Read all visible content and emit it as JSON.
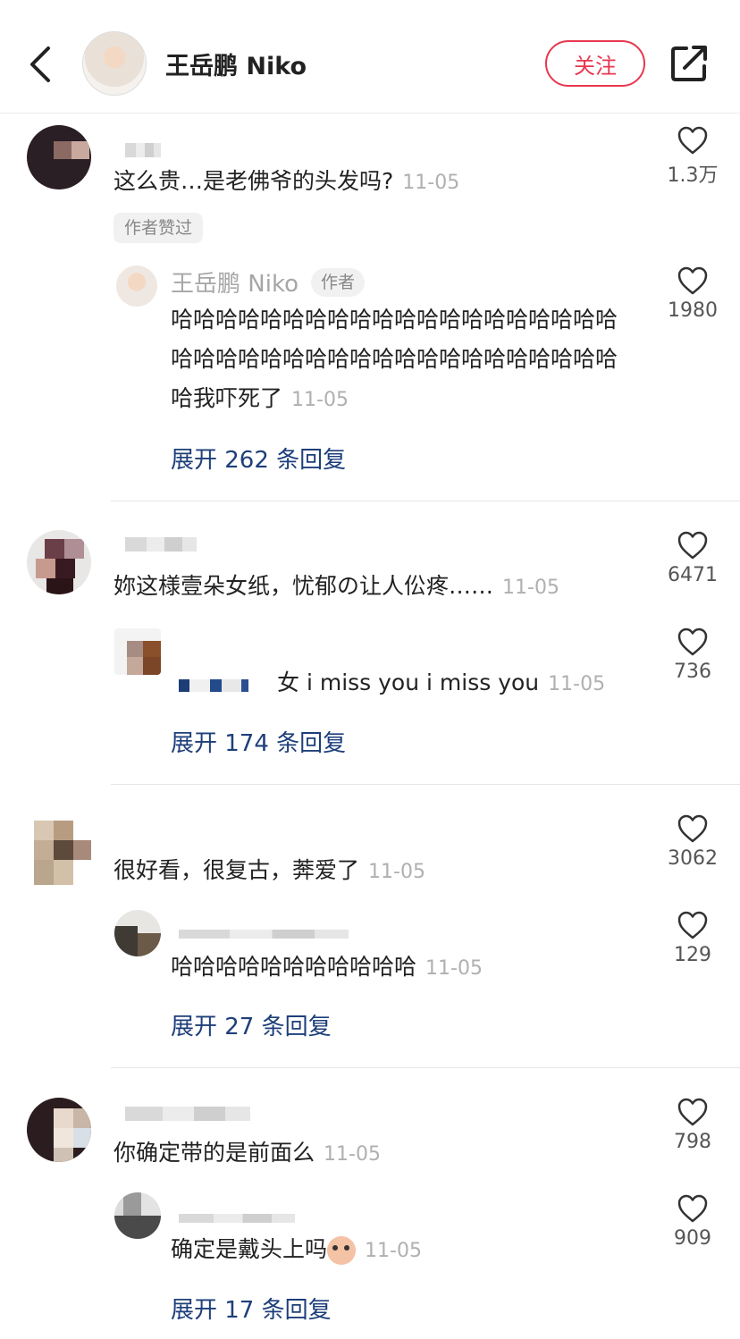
{
  "header": {
    "author_name": "王岳鹏 Niko",
    "follow_label": "关注"
  },
  "comments": [
    {
      "text": "这么贵…是老佛爷的头发吗?",
      "time": "11-05",
      "likes": "1.3万",
      "liked_tag": "作者赞过",
      "reply": {
        "author": "王岳鹏 Niko",
        "author_tag": "作者",
        "text": "哈哈哈哈哈哈哈哈哈哈哈哈哈哈哈哈哈哈哈哈哈哈哈哈哈哈哈哈哈哈哈哈哈哈哈哈哈哈哈哈哈我吓死了",
        "time": "11-05",
        "likes": "1980"
      },
      "expand": "展开 262 条回复"
    },
    {
      "text": "妳这様壹朵女纸，忧郁の让人伀疼……",
      "time": "11-05",
      "likes": "6471",
      "reply": {
        "text": "女 i miss you i miss you",
        "time": "11-05",
        "likes": "736"
      },
      "expand": "展开 174 条回复"
    },
    {
      "text": "很好看，很复古，莾爱了",
      "time": "11-05",
      "likes": "3062",
      "reply": {
        "text": "哈哈哈哈哈哈哈哈哈哈哈",
        "time": "11-05",
        "likes": "129"
      },
      "expand": "展开 27 条回复"
    },
    {
      "text": "你确定带的是前面么",
      "time": "11-05",
      "likes": "798",
      "reply": {
        "text": "确定是戴头上吗",
        "emoji": "crying-face-emoji",
        "time": "11-05",
        "likes": "909"
      },
      "expand": "展开 17 条回复"
    }
  ],
  "colors": {
    "accent": "#e8374f",
    "link": "#1e3f7a",
    "muted": "#b0b0b0"
  }
}
